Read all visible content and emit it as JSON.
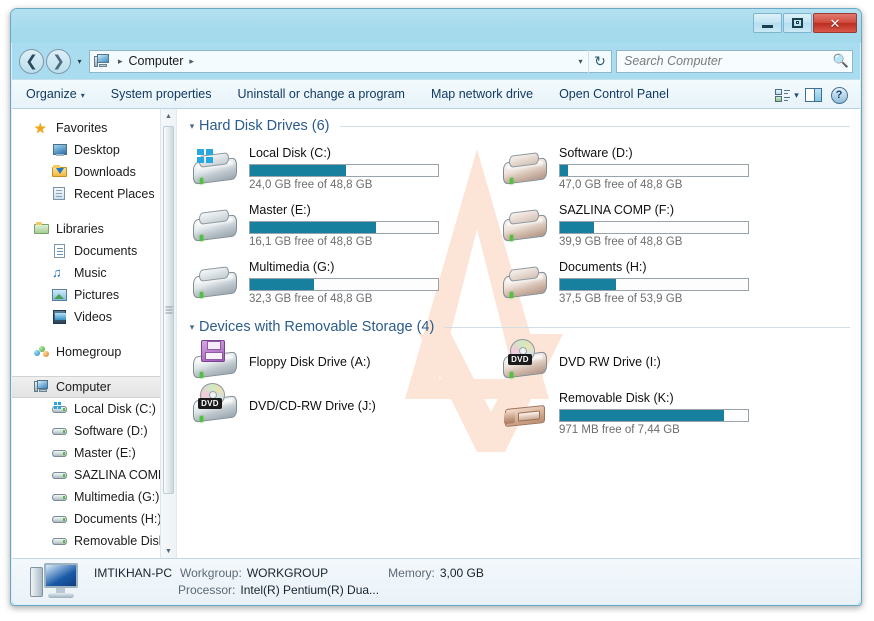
{
  "window": {
    "title": "Computer",
    "controls": {
      "minimize": "Minimize",
      "maximize": "Maximize",
      "close": "Close",
      "close_glyph": "✕"
    }
  },
  "addressbar": {
    "back": "Back",
    "forward": "Forward",
    "history_caret": "▾",
    "crumb_root": "Computer",
    "crumb_sep": "▸",
    "dropdown_caret": "▾",
    "refresh": "↻"
  },
  "search": {
    "placeholder": "Search Computer",
    "icon": "search-icon"
  },
  "commandbar": {
    "organize": "Organize",
    "organize_caret": "▾",
    "system_properties": "System properties",
    "uninstall": "Uninstall or change a program",
    "map_network_drive": "Map network drive",
    "open_control_panel": "Open Control Panel",
    "view_caret": "▾",
    "help_glyph": "?"
  },
  "sidebar": {
    "groups": [
      {
        "header": {
          "label": "Favorites",
          "icon": "star-icon"
        },
        "items": [
          {
            "label": "Desktop",
            "icon": "desktop-icon"
          },
          {
            "label": "Downloads",
            "icon": "downloads-folder-icon"
          },
          {
            "label": "Recent Places",
            "icon": "recent-places-icon"
          }
        ]
      },
      {
        "header": {
          "label": "Libraries",
          "icon": "libraries-icon"
        },
        "items": [
          {
            "label": "Documents",
            "icon": "document-icon"
          },
          {
            "label": "Music",
            "icon": "music-note-icon"
          },
          {
            "label": "Pictures",
            "icon": "picture-icon"
          },
          {
            "label": "Videos",
            "icon": "video-icon"
          }
        ]
      },
      {
        "header": {
          "label": "Homegroup",
          "icon": "homegroup-icon"
        },
        "items": []
      },
      {
        "header": {
          "label": "Computer",
          "icon": "computer-icon",
          "selected": true
        },
        "items": [
          {
            "label": "Local Disk (C:)",
            "icon": "hard-disk-icon"
          },
          {
            "label": "Software (D:)",
            "icon": "hard-disk-icon"
          },
          {
            "label": "Master (E:)",
            "icon": "hard-disk-icon"
          },
          {
            "label": "SAZLINA COMP",
            "icon": "hard-disk-icon"
          },
          {
            "label": "Multimedia (G:)",
            "icon": "hard-disk-icon"
          },
          {
            "label": "Documents (H:)",
            "icon": "hard-disk-icon"
          },
          {
            "label": "Removable Disk",
            "icon": "hard-disk-icon"
          }
        ]
      }
    ],
    "scroll_up": "▲",
    "scroll_down": "▼"
  },
  "content": {
    "sections": [
      {
        "title": "Hard Disk Drives (6)",
        "caret": "◢",
        "drives": [
          {
            "name": "Local Disk (C:)",
            "free": "24,0 GB free of 48,8 GB",
            "used_percent": 51,
            "icon": "hard-drive-windows-icon"
          },
          {
            "name": "Software (D:)",
            "free": "47,0 GB free of 48,8 GB",
            "used_percent": 4,
            "icon": "hard-drive-icon"
          },
          {
            "name": "Master (E:)",
            "free": "16,1 GB free of 48,8 GB",
            "used_percent": 67,
            "icon": "hard-drive-icon"
          },
          {
            "name": "SAZLINA COMP (F:)",
            "free": "39,9 GB free of 48,8 GB",
            "used_percent": 18,
            "icon": "hard-drive-icon"
          },
          {
            "name": "Multimedia (G:)",
            "free": "32,3 GB free of 48,8 GB",
            "used_percent": 34,
            "icon": "hard-drive-icon"
          },
          {
            "name": "Documents (H:)",
            "free": "37,5 GB free of 53,9 GB",
            "used_percent": 30,
            "icon": "hard-drive-icon"
          }
        ]
      },
      {
        "title": "Devices with Removable Storage (4)",
        "caret": "◢",
        "drives": [
          {
            "name": "Floppy Disk Drive (A:)",
            "free": "",
            "used_percent": null,
            "icon": "floppy-drive-icon"
          },
          {
            "name": "DVD RW Drive (I:)",
            "free": "",
            "used_percent": null,
            "icon": "dvd-drive-icon"
          },
          {
            "name": "DVD/CD-RW Drive (J:)",
            "free": "",
            "used_percent": null,
            "icon": "dvd-drive-icon"
          },
          {
            "name": "Removable Disk (K:)",
            "free": "971 MB free of 7,44 GB",
            "used_percent": 87,
            "icon": "usb-drive-icon"
          }
        ]
      }
    ]
  },
  "statusbar": {
    "computer_name": "IMTIKHAN-PC",
    "workgroup_label": "Workgroup:",
    "workgroup_value": "WORKGROUP",
    "memory_label": "Memory:",
    "memory_value": "3,00 GB",
    "processor_label": "Processor:",
    "processor_value": "Intel(R) Pentium(R) Dua..."
  },
  "colors": {
    "titlebar": "#a9dcee",
    "bar_fill": "#17809f",
    "section_title": "#2b5c8c",
    "command_text": "#123a63",
    "close_button": "#bb2d20"
  }
}
